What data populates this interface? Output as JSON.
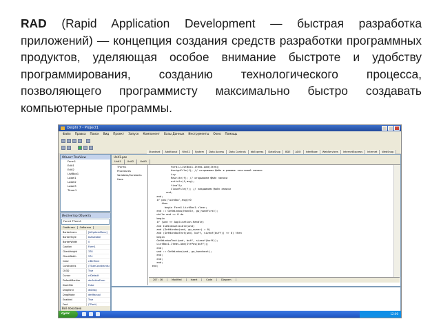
{
  "paragraph": {
    "term": "RAD",
    "text": " (Rapid Application Development — быстрая разработка приложений) — концепция создания средств разработки программных продуктов, уделяющая особое внимание быстроте и удобству программирования, созданию технологического процесса, позволяющего программисту максимально быстро создавать компьютерные программы."
  },
  "ide": {
    "title": "Delphi 7 - Project1",
    "menu": [
      "Файл",
      "Правка",
      "Поиск",
      "Вид",
      "Проект",
      "Запуск",
      "Компонент",
      "Базы Данных",
      "Инструменты",
      "Окно",
      "Помощь"
    ],
    "palette_tabs": [
      "Standard",
      "Additional",
      "Win32",
      "System",
      "Data Access",
      "Data Controls",
      "dbExpress",
      "DataSnap",
      "BDE",
      "ADO",
      "InterBase",
      "WebServices",
      "InternetExpress",
      "Internet",
      "WebSnap"
    ],
    "tree_header": "Объект TreeView",
    "tree_items": [
      "Form1",
      "Edit1",
      "Edit2",
      "ListBox1",
      "Label1",
      "Label2",
      "Label3",
      "Timer1"
    ],
    "inspector_header": "Инспектор Объекта",
    "inspector_combo": "Form1    TForm1",
    "inspector_tabs": [
      "Свойства",
      "События"
    ],
    "properties": [
      {
        "k": "BorderIcons",
        "v": "[biSystemMenu]"
      },
      {
        "k": "BorderStyle",
        "v": "bsSizeable"
      },
      {
        "k": "BorderWidth",
        "v": "0"
      },
      {
        "k": "Caption",
        "v": "Form1"
      },
      {
        "k": "ClientHeight",
        "v": "378"
      },
      {
        "k": "ClientWidth",
        "v": "574"
      },
      {
        "k": "Color",
        "v": "clBtnFace"
      },
      {
        "k": "Constraints",
        "v": "(TSizeConstraints)"
      },
      {
        "k": "Ctl3D",
        "v": "True"
      },
      {
        "k": "Cursor",
        "v": "crDefault"
      },
      {
        "k": "DefaultMonitor",
        "v": "dmActiveForm"
      },
      {
        "k": "DockSite",
        "v": "False"
      },
      {
        "k": "DragKind",
        "v": "dkDrag"
      },
      {
        "k": "DragMode",
        "v": "dmManual"
      },
      {
        "k": "Enabled",
        "v": "True"
      },
      {
        "k": "Font",
        "v": "(TFont)"
      }
    ],
    "inspector_footer": "Всё показано",
    "editor_title": "Unit1.pas",
    "editor_tabs": [
      "Unit1",
      "Unit2",
      "Unit3"
    ],
    "explorer_items": [
      "TForm1",
      "Procedures",
      "Variables/Constants",
      "Uses"
    ],
    "code": [
      "              Form1.ListBox1.Items.Add(Item);",
      "              AssignFile(f); // открываем файл в режиме текстовой записи",
      "              try",
      "              Rewrite(f); // открываем файл записи",
      "              writeln(f,msg);",
      "              finally",
      "              CloseFile(f); // закрываем файл записи",
      "           end;",
      "     end;",
      "     if pos('window',msg)>0",
      "        then",
      "          begin Form1.ListBox1.clear;",
      "     end := GetWindow(handle, gw_hwndfirst);",
      "     while wnd <> 0 do",
      "     begin",
      "     if (wnd <> Application.Handle)",
      "     and IsWindowVisible(wnd)",
      "     and (GetWindow(wnd, gw_owner) = 0)",
      "     and (GetWindowText(wnd, buff, sizeof(buff)) <> 0) then",
      "     begin",
      "     GetWindowText(wnd, buff, sizeof(buff));",
      "     ListBox1.Items.Add(StrPas(buff));",
      "     end;",
      "     wnd := GetWindow(wnd, gw_hwndnext);",
      "     end;",
      "     end;",
      "     end;",
      "  end;"
    ],
    "status": [
      "207 : 16",
      "Modified",
      "Insert",
      "Code",
      "Diagram"
    ],
    "start_label": "пуск",
    "clock": "12:00"
  }
}
